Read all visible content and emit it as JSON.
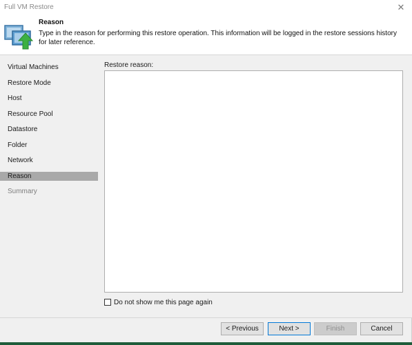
{
  "window": {
    "title": "Full VM Restore",
    "close_icon": "close-icon"
  },
  "header": {
    "title": "Reason",
    "description": "Type in the reason for performing this restore operation. This information will be logged in the restore sessions history for later reference.",
    "icon": "vm-restore-icon"
  },
  "sidebar": {
    "items": [
      {
        "label": "Virtual Machines",
        "state": "normal"
      },
      {
        "label": "Restore Mode",
        "state": "normal"
      },
      {
        "label": "Host",
        "state": "normal"
      },
      {
        "label": "Resource Pool",
        "state": "normal"
      },
      {
        "label": "Datastore",
        "state": "normal"
      },
      {
        "label": "Folder",
        "state": "normal"
      },
      {
        "label": "Network",
        "state": "normal"
      },
      {
        "label": "Reason",
        "state": "active"
      },
      {
        "label": "Summary",
        "state": "dim"
      }
    ]
  },
  "main": {
    "reason_label": "Restore reason:",
    "reason_value": "",
    "checkbox_label": "Do not show me this page again",
    "checkbox_checked": false
  },
  "footer": {
    "previous_label": "< Previous",
    "next_label": "Next >",
    "finish_label": "Finish",
    "cancel_label": "Cancel"
  },
  "colors": {
    "accent": "#0078d7",
    "active_item": "#a9a9a9",
    "icon_arrow": "#3cb043"
  }
}
